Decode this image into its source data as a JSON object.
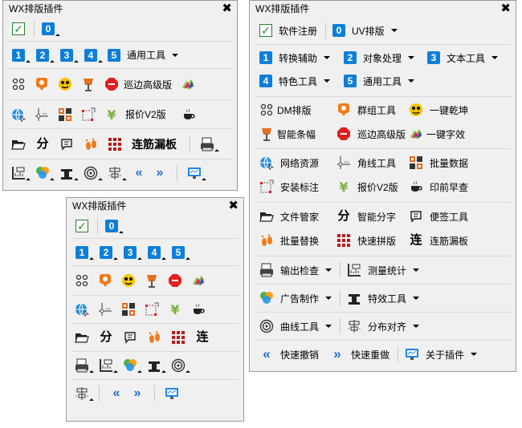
{
  "panels": {
    "p1": {
      "title": "WX排版插件",
      "close": "✖"
    },
    "p2": {
      "title": "WX排版插件",
      "close": "✖"
    },
    "p3": {
      "title": "WX排版插件",
      "close": "✖"
    }
  },
  "p1": {
    "r1": {
      "zero": "0"
    },
    "r2": {
      "n1": "1",
      "n2": "2",
      "n3": "3",
      "n4": "4",
      "n5": "5",
      "general": "通用工具"
    },
    "r3": {
      "patrol": "巡边高级版"
    },
    "r4": {
      "quote": "报价V2版"
    },
    "r5": {
      "steel": "连筋漏板"
    }
  },
  "p2": {
    "r1": {
      "zero": "0"
    },
    "r2": {
      "n1": "1",
      "n2": "2",
      "n3": "3",
      "n4": "4",
      "n5": "5"
    }
  },
  "p3": {
    "register": "软件注册",
    "uv": "UV排版",
    "n1": "1",
    "convert": "转换辅助",
    "n2": "2",
    "object": "对象处理",
    "n3": "3",
    "text": "文本工具",
    "n4": "4",
    "special": "特色工具",
    "n5": "5",
    "general": "通用工具",
    "dm": "DM排版",
    "group": "群组工具",
    "oneclick": "一键乾坤",
    "smartbar": "智能条幅",
    "patrol": "巡边高级版",
    "oneword": "一键字效",
    "network": "网络资源",
    "corner": "角线工具",
    "batchdata": "批量数据",
    "install": "安装标注",
    "quote": "报价V2版",
    "stamp": "印前早查",
    "file": "文件管家",
    "split": "智能分字",
    "note": "便签工具",
    "replace": "批量替换",
    "fastpuzzle": "快速拼版",
    "steel": "连筋漏板",
    "output": "输出检查",
    "measure": "测量统计",
    "ad": "广告制作",
    "effect": "特效工具",
    "curve": "曲线工具",
    "distribute": "分布对齐",
    "undo": "快速撤销",
    "redo": "快速重做",
    "about": "关于插件"
  },
  "colors": {
    "accent": "#0e7fd8",
    "panel_bg": "#f0f0f0",
    "border": "#9a9a9a",
    "check": "#2a8a2a"
  }
}
